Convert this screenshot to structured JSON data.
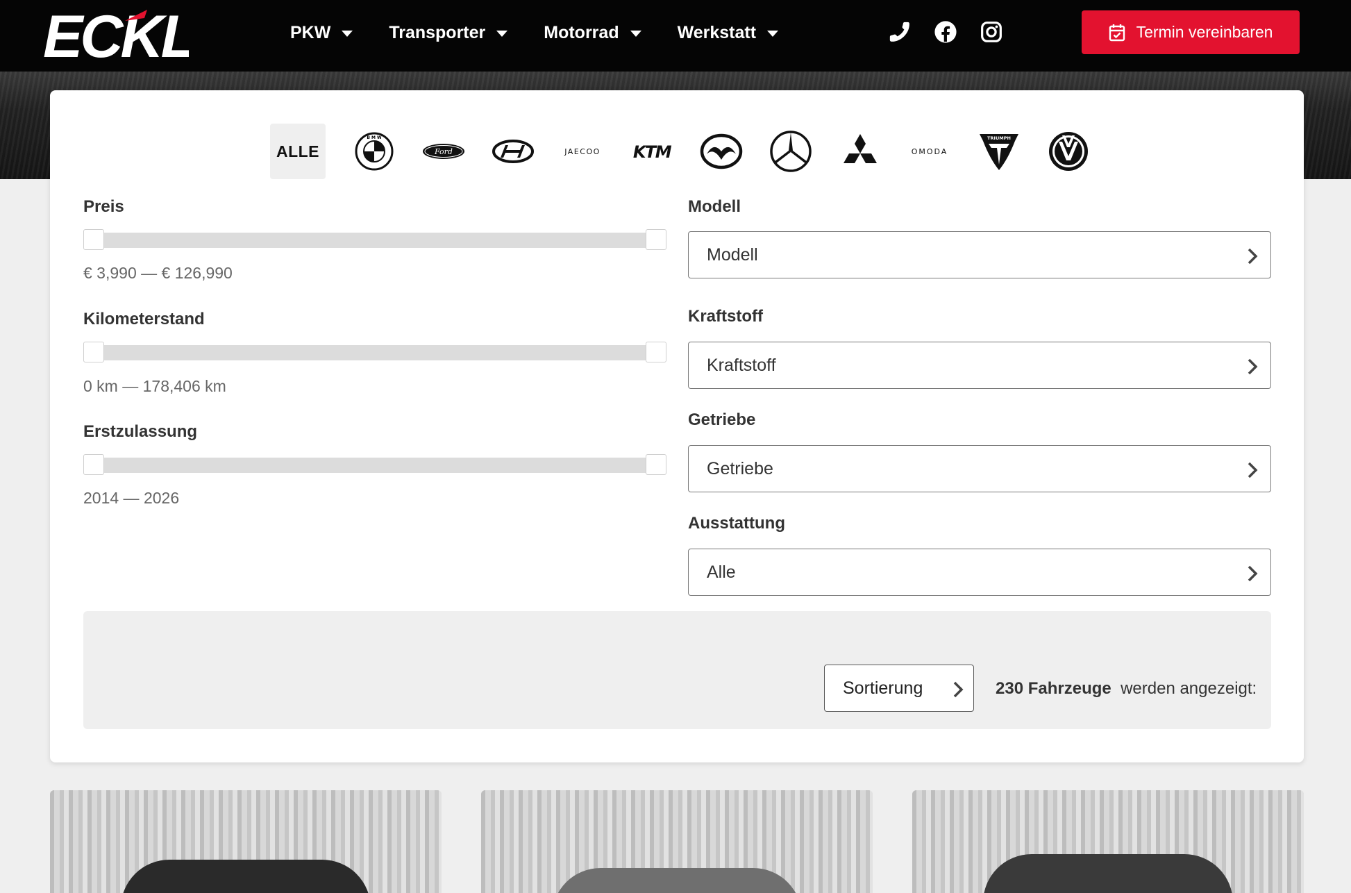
{
  "brand_colors": {
    "accent": "#e3122f",
    "header_bg": "#050505"
  },
  "header": {
    "logo_text": "ECKL",
    "nav": [
      {
        "label": "PKW"
      },
      {
        "label": "Transporter"
      },
      {
        "label": "Motorrad"
      },
      {
        "label": "Werkstatt"
      }
    ],
    "social_icons": [
      "phone-icon",
      "facebook-icon",
      "instagram-icon"
    ],
    "cta_label": "Termin vereinbaren"
  },
  "brands": {
    "all_label": "ALLE",
    "items": [
      "bmw-logo",
      "ford-logo",
      "hyundai-logo",
      "jaecoo-logo",
      "ktm-logo",
      "mazda-logo",
      "mercedes-logo",
      "mitsubishi-logo",
      "omoda-logo",
      "triumph-logo",
      "vw-logo"
    ],
    "jaecoo_text": "JAECOO",
    "ktm_text": "KTM",
    "omoda_text": "OMODA",
    "triumph_text": "TRIUMPH",
    "ford_text": "Ford"
  },
  "filters": {
    "price": {
      "label": "Preis",
      "range": "€ 3,990 — € 126,990"
    },
    "mileage": {
      "label": "Kilometerstand",
      "range": "0 km — 178,406 km"
    },
    "registration": {
      "label": "Erstzulassung",
      "range": "2014 — 2026"
    },
    "model": {
      "label": "Modell",
      "value": "Modell"
    },
    "fuel": {
      "label": "Kraftstoff",
      "value": "Kraftstoff"
    },
    "gearbox": {
      "label": "Getriebe",
      "value": "Getriebe"
    },
    "equipment": {
      "label": "Ausstattung",
      "value": "Alle"
    }
  },
  "results": {
    "sort_label": "Sortierung",
    "count_label": "230 Fahrzeuge",
    "count_suffix": "werden angezeigt:"
  }
}
